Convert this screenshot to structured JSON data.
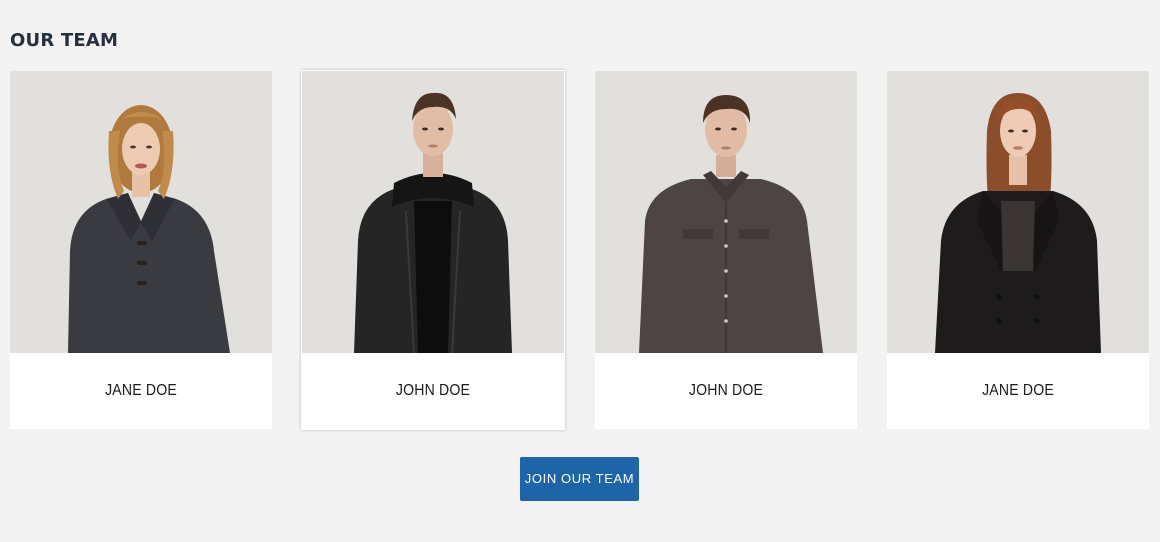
{
  "section": {
    "title": "OUR TEAM"
  },
  "members": [
    {
      "name": "JANE DOE",
      "photo": "woman-in-grey-wool-coat"
    },
    {
      "name": "JOHN DOE",
      "photo": "man-in-black-leather-jacket"
    },
    {
      "name": "JOHN DOE",
      "photo": "man-in-brown-shirt"
    },
    {
      "name": "JANE DOE",
      "photo": "woman-in-black-pea-coat"
    }
  ],
  "cta": {
    "label": "JOIN OUR TEAM"
  },
  "colors": {
    "page_background": "#f3f3f3",
    "photo_background": "#e2e0dd",
    "title_text": "#25303f",
    "button_background": "#1e64a8",
    "button_text": "#ffffff"
  }
}
